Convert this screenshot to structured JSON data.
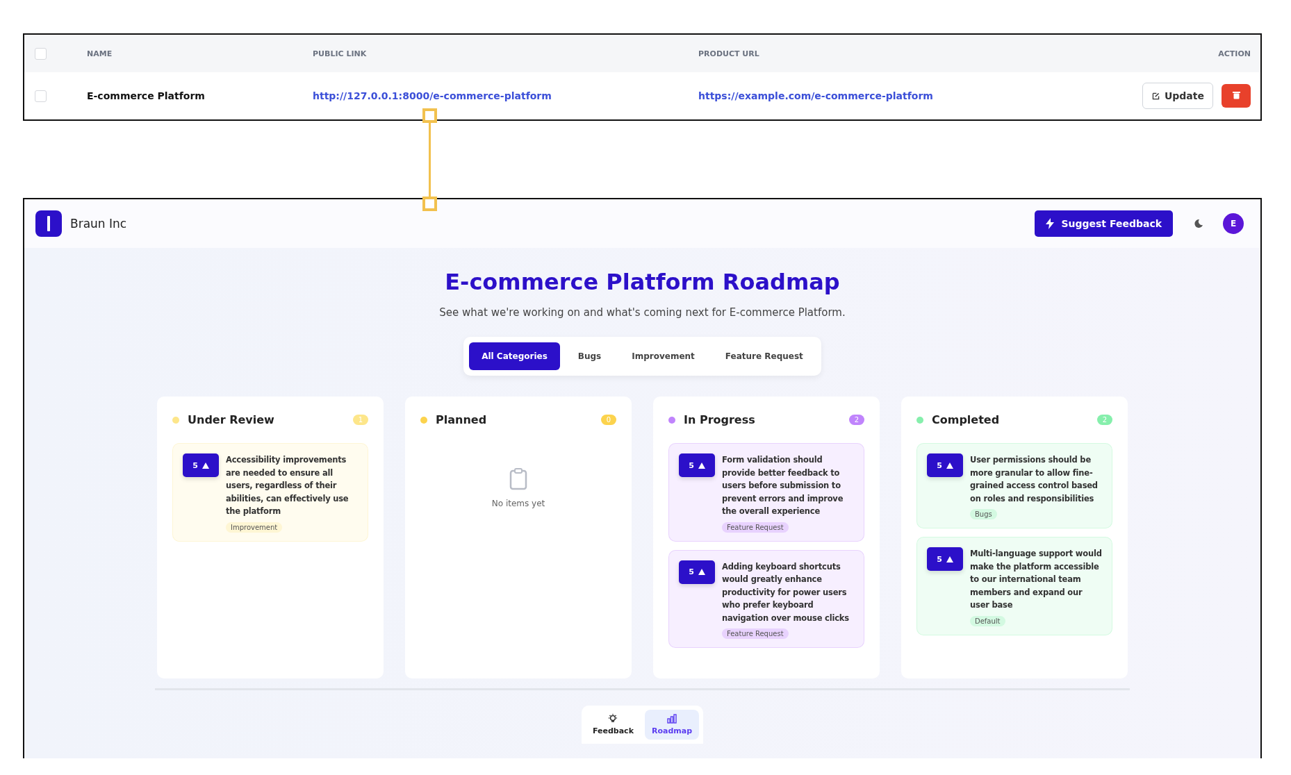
{
  "table": {
    "columns": [
      "NAME",
      "PUBLIC LINK",
      "PRODUCT URL",
      "ACTION"
    ],
    "rows": [
      {
        "checked": false,
        "name": "E-commerce Platform",
        "public_link": "http://127.0.0.1:8000/e-commerce-platform",
        "product_url": "https://example.com/e-commerce-platform",
        "update_label": "Update"
      }
    ],
    "header_checked": false
  },
  "header": {
    "brand": "Braun Inc",
    "suggest_button": "Suggest Feedback",
    "avatar": "E"
  },
  "title": "E-commerce Platform Roadmap",
  "subtitle": "See what we're working on and what's coming next for E-commerce Platform.",
  "tabs": [
    {
      "label": "All Categories",
      "selected": true
    },
    {
      "label": "Bugs",
      "selected": false
    },
    {
      "label": "Improvement",
      "selected": false
    },
    {
      "label": "Feature Request",
      "selected": false
    }
  ],
  "columns": [
    {
      "title": "Under Review",
      "count": "1",
      "color": "#fde68a",
      "items": [
        {
          "votes": "5",
          "text": "Accessibility improvements are needed to ensure all users, regardless of their abilities, can effectively use the platform",
          "tag": "Improvement"
        }
      ]
    },
    {
      "title": "Planned",
      "count": "0",
      "color": "#fcd34d",
      "empty_text": "No items yet"
    },
    {
      "title": "In Progress",
      "count": "2",
      "color": "#c084fc",
      "items": [
        {
          "votes": "5",
          "text": "Form validation should provide better feedback to users before submission to prevent errors and improve the overall experience",
          "tag": "Feature Request"
        },
        {
          "votes": "5",
          "text": "Adding keyboard shortcuts would greatly enhance productivity for power users who prefer keyboard navigation over mouse clicks",
          "tag": "Feature Request"
        }
      ]
    },
    {
      "title": "Completed",
      "count": "2",
      "color": "#86efac",
      "items": [
        {
          "votes": "5",
          "text": "User permissions should be more granular to allow fine-grained access control based on roles and responsibilities",
          "tag": "Bugs"
        },
        {
          "votes": "5",
          "text": "Multi-language support would make the platform accessible to our international team members and expand our user base",
          "tag": "Default"
        }
      ]
    }
  ],
  "bottom_nav": [
    {
      "label": "Feedback",
      "kind": "feedback",
      "selected": false
    },
    {
      "label": "Roadmap",
      "kind": "roadmap",
      "selected": true
    }
  ]
}
